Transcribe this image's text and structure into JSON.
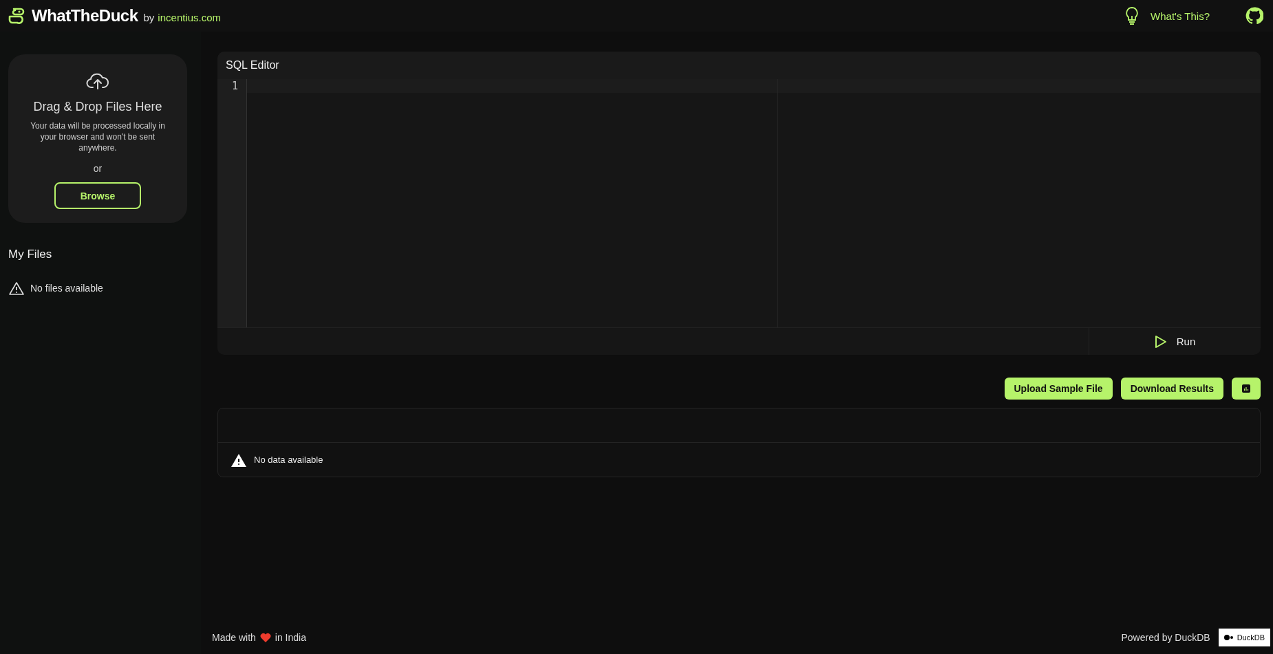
{
  "header": {
    "brand": "WhatTheDuck",
    "by": "by",
    "by_link": "incentius.com",
    "help_link": "What's This?"
  },
  "upload": {
    "title": "Drag & Drop Files Here",
    "note": "Your data will be processed locally in your browser and won't be sent anywhere.",
    "or": "or",
    "button": "Browse"
  },
  "files": {
    "title": "My Files",
    "empty": "No files available"
  },
  "editor": {
    "title": "SQL Editor",
    "line_numbers": [
      "1"
    ],
    "run": "Run"
  },
  "actions": [
    {
      "kind": "text",
      "label": "Upload Sample File"
    },
    {
      "kind": "text",
      "label": "Download Results"
    },
    {
      "kind": "chart"
    }
  ],
  "results": {
    "empty": "No data available"
  },
  "footer": {
    "made_before": "Made with",
    "made_after": "in India",
    "powered": "Powered by DuckDB",
    "badge": "DuckDB"
  }
}
